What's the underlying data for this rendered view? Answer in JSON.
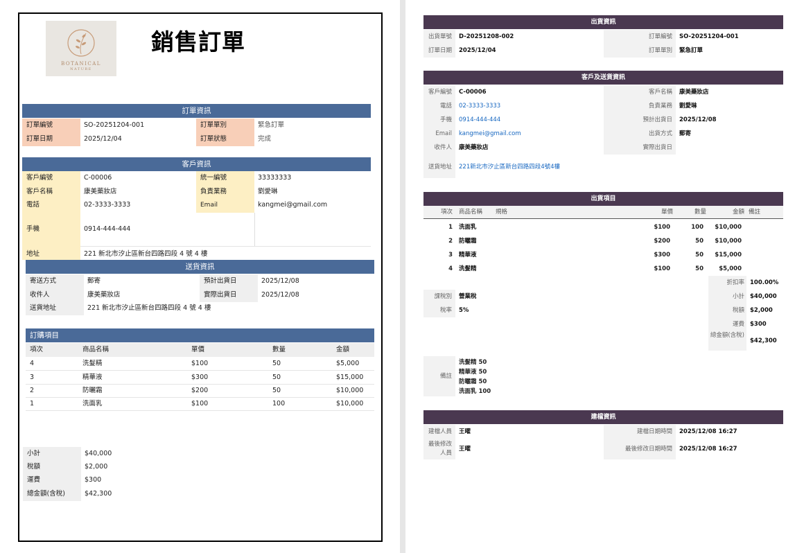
{
  "title": "銷售訂單",
  "logo": {
    "line1": "BOTANICAL",
    "line2": "NATURE"
  },
  "order_info": {
    "header": "訂單資訊",
    "rows": [
      {
        "l1": "訂單編號",
        "v1": "SO-20251204-001",
        "l2": "訂單單別",
        "v2": "緊急訂單"
      },
      {
        "l1": "訂單日期",
        "v1": "2025/12/04",
        "l2": "訂單狀態",
        "v2": "完成"
      }
    ]
  },
  "customer_info": {
    "header": "客戶資訊",
    "rows": [
      {
        "l1": "客戶編號",
        "v1": "C-00006",
        "l2": "統一編號",
        "v2": "33333333"
      },
      {
        "l1": "客戶名稱",
        "v1": "康美藥妝店",
        "l2": "負責業務",
        "v2": "劉愛琳"
      },
      {
        "l1": "電話",
        "v1": "02-3333-3333",
        "l2": "Email",
        "v2": "kangmei@gmail.com"
      }
    ],
    "mobile_label": "手機",
    "mobile": "0914-444-444",
    "address_label": "地址",
    "address": "221 新北市汐止區新台四路四段 4 號 4 樓"
  },
  "shipping_info": {
    "header": "送貨資訊",
    "rows": [
      {
        "l1": "寄送方式",
        "v1": "郵寄",
        "l2": "預計出貨日",
        "v2": "2025/12/08"
      },
      {
        "l1": "收件人",
        "v1": "康美藥妝店",
        "l2": "實際出貨日",
        "v2": "2025/12/08"
      }
    ],
    "address_label": "送貨地址",
    "address": "221 新北市汐止區新台四路四段 4 號 4 樓"
  },
  "order_items": {
    "header": "訂購項目",
    "columns": [
      "項次",
      "商品名稱",
      "單價",
      "數量",
      "金額"
    ],
    "rows": [
      [
        "4",
        "洗髮精",
        "$100",
        "50",
        "$5,000"
      ],
      [
        "3",
        "精華液",
        "$300",
        "50",
        "$15,000"
      ],
      [
        "2",
        "防曬霜",
        "$200",
        "50",
        "$10,000"
      ],
      [
        "1",
        "洗面乳",
        "$100",
        "100",
        "$10,000"
      ]
    ]
  },
  "totals": [
    {
      "label": "小計",
      "value": "$40,000"
    },
    {
      "label": "稅額",
      "value": "$2,000"
    },
    {
      "label": "運費",
      "value": "$300"
    },
    {
      "label": "總金額(含稅)",
      "value": "$42,300"
    }
  ],
  "r_shipping": {
    "header": "出貨資訊",
    "rows": [
      {
        "l1": "出貨單號",
        "v1": "D-20251208-002",
        "l2": "訂單編號",
        "v2": "SO-20251204-001"
      },
      {
        "l1": "訂單日期",
        "v1": "2025/12/04",
        "l2": "訂單單別",
        "v2": "緊急訂單"
      }
    ]
  },
  "r_customer": {
    "header": "客戶及送貨資訊",
    "rows": [
      {
        "l1": "客戶編號",
        "v1": "C-00006",
        "l2": "客戶名稱",
        "v2": "康美藥妝店"
      },
      {
        "l1": "電話",
        "v1": "02-3333-3333",
        "l2": "負責業務",
        "v2": "劉愛琳"
      },
      {
        "l1": "手機",
        "v1": "0914-444-444",
        "l2": "預計出貨日",
        "v2": "2025/12/08"
      },
      {
        "l1": "Email",
        "v1": "kangmei@gmail.com",
        "l2": "出貨方式",
        "v2": "郵寄"
      },
      {
        "l1": "收件人",
        "v1": "康美藥妝店",
        "l2": "實際出貨日",
        "v2": ""
      }
    ],
    "address_label": "送貨地址",
    "address": "221新北市汐止區新台四路四段4號4樓"
  },
  "r_items": {
    "header": "出貨項目",
    "columns": [
      "項次",
      "商品名稱",
      "規格",
      "單價",
      "數量",
      "金額",
      "備註"
    ],
    "rows": [
      [
        "1",
        "洗面乳",
        "",
        "$100",
        "100",
        "$10,000",
        ""
      ],
      [
        "2",
        "防曬霜",
        "",
        "$200",
        "50",
        "$10,000",
        ""
      ],
      [
        "3",
        "精華液",
        "",
        "$300",
        "50",
        "$15,000",
        ""
      ],
      [
        "4",
        "洗髮精",
        "",
        "$100",
        "50",
        "$5,000",
        ""
      ]
    ]
  },
  "r_summary": {
    "discount_label": "折扣率",
    "discount": "100.00%",
    "tax_type_label": "課稅別",
    "tax_type": "營業稅",
    "tax_rate_label": "稅率",
    "tax_rate": "5%",
    "subtotal_label": "小計",
    "subtotal": "$40,000",
    "tax_label": "稅額",
    "tax": "$2,000",
    "freight_label": "運費",
    "freight": "$300",
    "total_label": "總金額(含稅)",
    "total": "$42,300"
  },
  "r_remarks": {
    "label": "備註",
    "lines": [
      "洗髮精 50",
      "精華液 50",
      "防曬霜 50",
      "洗面乳 100"
    ]
  },
  "r_audit": {
    "header": "建檔資訊",
    "creator_label": "建檔人員",
    "creator": "王曜",
    "created_label": "建檔日期時間",
    "created": "2025/12/08 16:27",
    "modifier_label": "最後修改人員",
    "modifier": "王曜",
    "modified_label": "最後修改日期時間",
    "modified": "2025/12/08 16:27"
  },
  "colors": {
    "left_header": "#4a6a98",
    "right_header": "#4a3850",
    "peach": "#f8cfb8",
    "yellow": "#fdefc4",
    "link": "#1566c0"
  }
}
